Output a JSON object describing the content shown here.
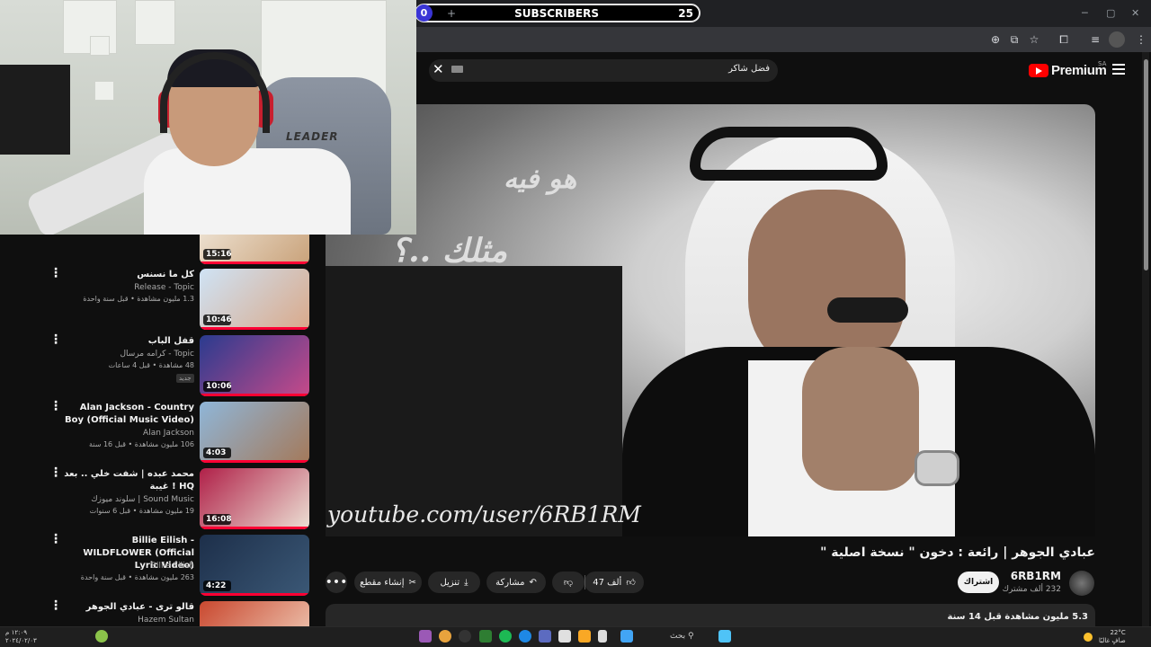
{
  "subscriber_counter": {
    "left_count": "0",
    "plus": "+",
    "label": "SUBSCRIBERS",
    "right_count": "25"
  },
  "webcam": {
    "chair_brand": "LEADER"
  },
  "youtube": {
    "search_query": "فضل شاكر",
    "logo_word": "Premium",
    "region": "SA",
    "video_caption_line1": "هو فيه",
    "video_caption_line2": "مثلك ..؟",
    "video_watermark": "youtube.com/user/6RB1RM",
    "video_title": "عبادي الجوهر | رائعة : دخون \" نسخة اصلية \"",
    "channel_name": "6RB1RM",
    "channel_subscribers": "232 ألف مشترك",
    "subscribe_label": "اشتراك",
    "like_count": "47 ألف",
    "share_label": "مشاركة",
    "download_label": "تنزيل",
    "clip_label": "إنشاء مقطع",
    "more_label": "•••",
    "description_stats": "5.3 مليون مشاهدة  قبل 14 سنة"
  },
  "recommendations": [
    {
      "title": "",
      "channel": "",
      "meta": "",
      "duration": "15:16",
      "colors": [
        "#f3ece0",
        "#c9a27a"
      ]
    },
    {
      "title": "كل ما نسنس",
      "channel": "Release - Topic",
      "meta": "1.3 مليون مشاهدة • قبل سنة واحدة",
      "duration": "10:46",
      "colors": [
        "#cfe3f5",
        "#d9a98a"
      ]
    },
    {
      "title": "قفل الباب",
      "channel": "كرامه مرسال - Topic",
      "meta": "48 مشاهدة • قبل 4 ساعات",
      "duration": "10:06",
      "badge": "جديد",
      "colors": [
        "#2a3b8f",
        "#c74a8a"
      ]
    },
    {
      "title": "Alan Jackson - Country Boy (Official Music Video)",
      "channel": "Alan Jackson",
      "meta": "106 مليون مشاهدة • قبل 16 سنة",
      "duration": "4:03",
      "colors": [
        "#8fb6d8",
        "#a4795a"
      ]
    },
    {
      "title": "محمد عبده | شفت خلي .. بعد غيبة ! HQ",
      "channel": "سلوند ميوزك | Sound Music",
      "meta": "19 مليون مشاهدة • قبل 6 سنوات",
      "duration": "16:08",
      "colors": [
        "#b02048",
        "#ece0d4"
      ]
    },
    {
      "title": "Billie Eilish - WILDFLOWER (Official Lyric Video)",
      "channel": "Billie Eilish",
      "meta": "263 مليون مشاهدة • قبل سنة واحدة",
      "duration": "4:22",
      "colors": [
        "#1d2f4a",
        "#3b5876"
      ]
    },
    {
      "title": "قالو ترى - عبادي الجوهر",
      "channel": "Hazem Sultan",
      "meta": "",
      "duration": "",
      "colors": [
        "#c9482f",
        "#f2d6c2"
      ]
    }
  ],
  "taskbar": {
    "search_label": "بحث",
    "time": "١٢:٠٩ م",
    "date": "٢٠٢٤/٠٢/٠٣",
    "weather_temp": "22°C",
    "weather_desc": "صافٍ غالبًا"
  }
}
